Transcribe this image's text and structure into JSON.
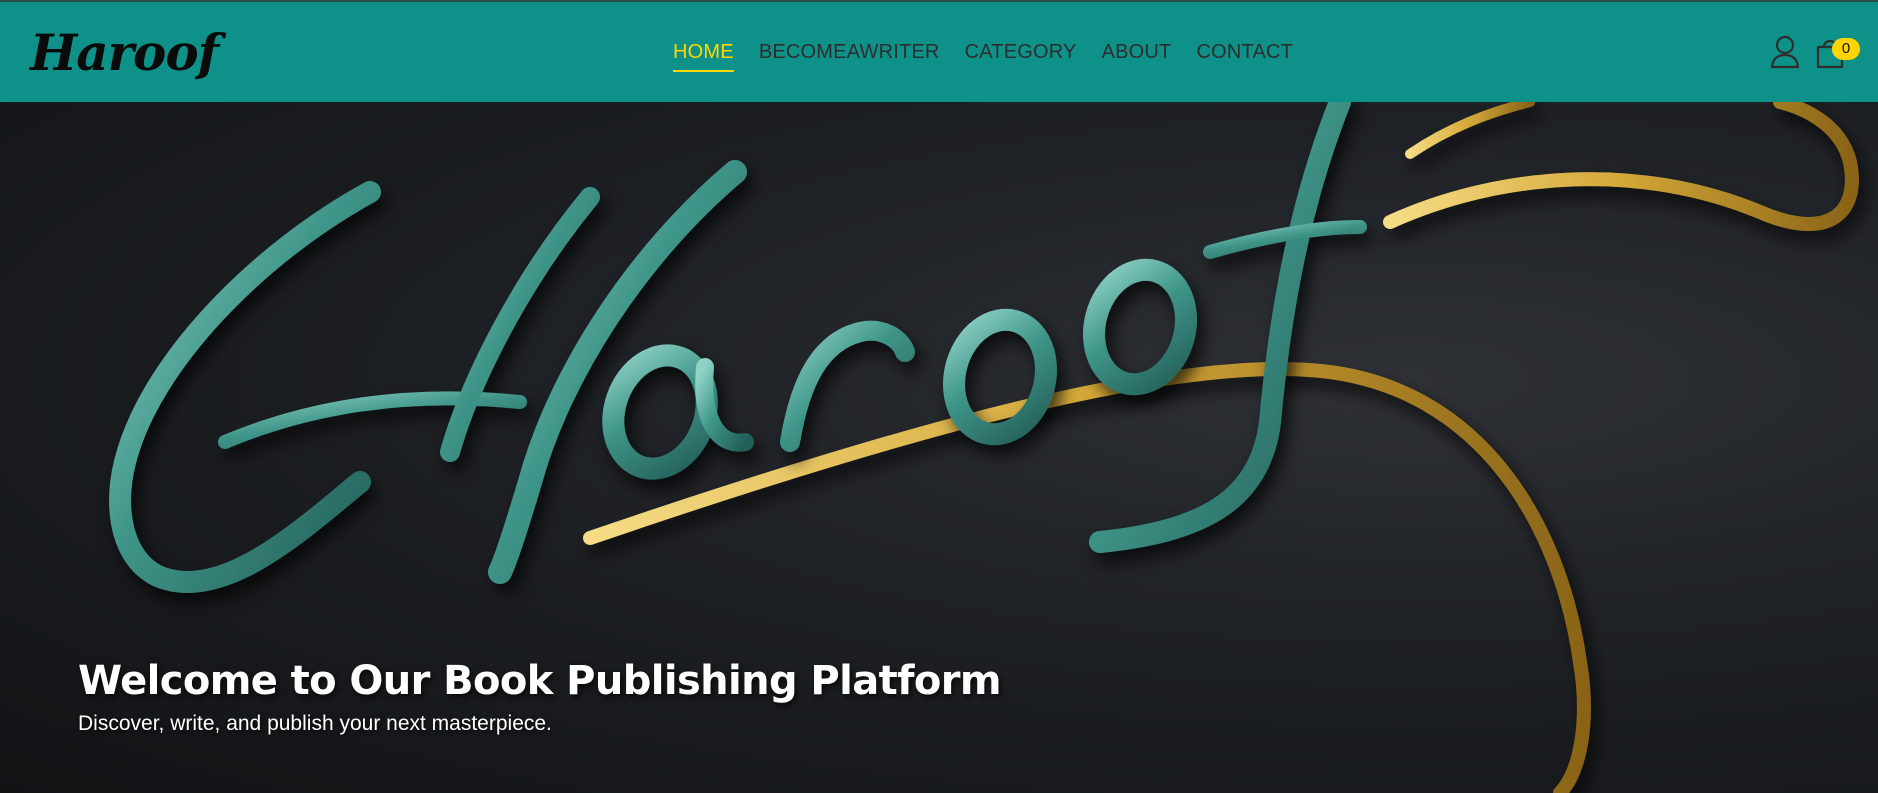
{
  "header": {
    "logo_text": "Haroof",
    "nav": [
      {
        "label": "HOME",
        "active": true
      },
      {
        "label": "BECOMEAWRITER",
        "active": false
      },
      {
        "label": "CATEGORY",
        "active": false
      },
      {
        "label": "ABOUT",
        "active": false
      },
      {
        "label": "CONTACT",
        "active": false
      }
    ],
    "user_icon": "user-icon",
    "cart_icon": "shopping-bag-icon",
    "cart_count": "0"
  },
  "hero": {
    "image_text": "Haroof",
    "title": "Welcome to Our Book Publishing Platform",
    "subtitle": "Discover, write, and publish your next masterpiece."
  },
  "colors": {
    "navbar_bg": "#0e9188",
    "active_link": "#ffd700",
    "nav_text": "#2d2d2d",
    "badge": "#ffd400",
    "hero_bg": "#1f2226",
    "lettering_teal": "#4fa79c",
    "flourish_gold": "#d4a838"
  }
}
